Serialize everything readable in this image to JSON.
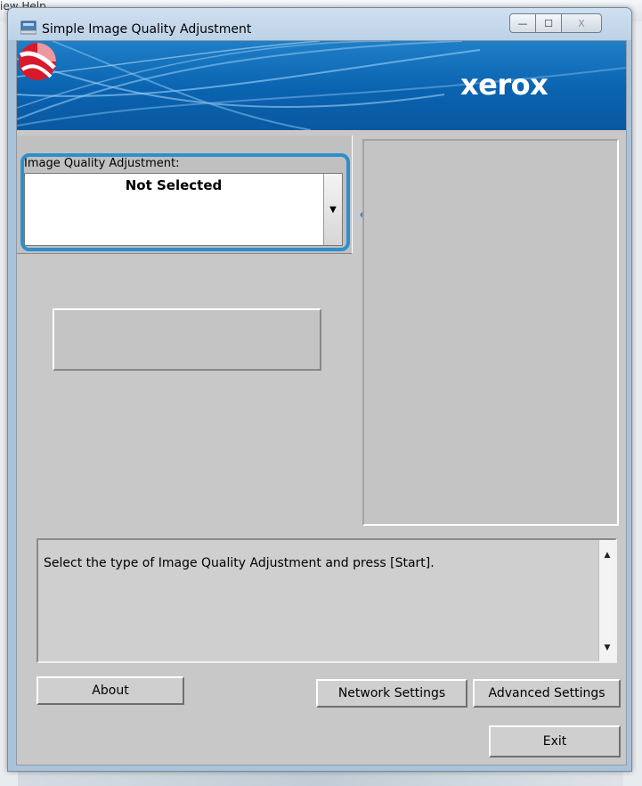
{
  "background": {
    "menu_text": "iew    Help"
  },
  "window": {
    "title": "Simple Image Quality Adjustment",
    "controls": {
      "minimize": "—",
      "maximize": "☐",
      "close": "X"
    }
  },
  "banner": {
    "brand": "xerox",
    "colors": {
      "primary": "#0a63b0",
      "logo_red": "#d7192a"
    }
  },
  "image_quality": {
    "label": "Image Quality Adjustment:",
    "selected": "Not Selected",
    "dropdown_glyph": "▼"
  },
  "message": {
    "text": "Select the type of Image Quality Adjustment and press [Start].",
    "scroll_up": "▲",
    "scroll_down": "▼"
  },
  "buttons": {
    "about": "About",
    "network_settings": "Network Settings",
    "advanced_settings": "Advanced Settings",
    "exit": "Exit"
  },
  "annotation": {
    "callout_color": "#2f8fcd"
  }
}
